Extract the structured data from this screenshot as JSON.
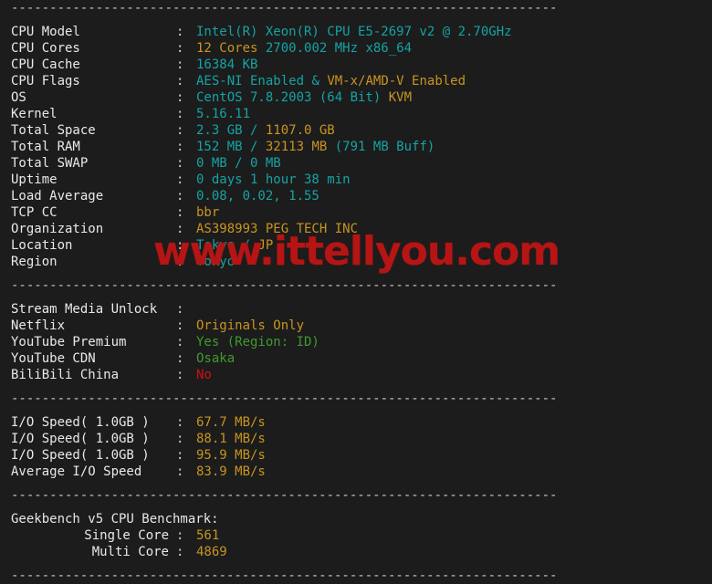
{
  "terminal": {
    "separator": "-----------------------------------------------------------------------",
    "watermark": "www.ittellyou.com",
    "colon": ":",
    "sections": [
      {
        "name": "system-info",
        "rows": [
          {
            "label": "CPU Model",
            "parts": [
              {
                "t": "Intel(R) Xeon(R) CPU E5-2697 v2 @ 2.70GHz",
                "c": "teal"
              }
            ]
          },
          {
            "label": "CPU Cores",
            "parts": [
              {
                "t": "12 Cores",
                "c": "orange"
              },
              {
                "t": " ",
                "c": "teal"
              },
              {
                "t": "2700.002 MHz x86_64",
                "c": "teal"
              }
            ]
          },
          {
            "label": "CPU Cache",
            "parts": [
              {
                "t": "16384 KB",
                "c": "teal"
              }
            ]
          },
          {
            "label": "CPU Flags",
            "parts": [
              {
                "t": "AES-NI Enabled",
                "c": "teal"
              },
              {
                "t": " & ",
                "c": "teal"
              },
              {
                "t": "VM-x/AMD-V Enabled",
                "c": "orange"
              }
            ]
          },
          {
            "label": "OS",
            "parts": [
              {
                "t": "CentOS 7.8.2003 (64 Bit) ",
                "c": "teal"
              },
              {
                "t": "KVM",
                "c": "orange"
              }
            ]
          },
          {
            "label": "Kernel",
            "parts": [
              {
                "t": "5.16.11",
                "c": "teal"
              }
            ]
          },
          {
            "label": "Total Space",
            "parts": [
              {
                "t": "2.3 GB",
                "c": "teal"
              },
              {
                "t": " / ",
                "c": "teal"
              },
              {
                "t": "1107.0 GB",
                "c": "orange"
              }
            ]
          },
          {
            "label": "Total RAM",
            "parts": [
              {
                "t": "152 MB",
                "c": "teal"
              },
              {
                "t": " / ",
                "c": "teal"
              },
              {
                "t": "32113 MB",
                "c": "orange"
              },
              {
                "t": " (791 MB Buff)",
                "c": "teal"
              }
            ]
          },
          {
            "label": "Total SWAP",
            "parts": [
              {
                "t": "0 MB / 0 MB",
                "c": "teal"
              }
            ]
          },
          {
            "label": "Uptime",
            "parts": [
              {
                "t": "0 days 1 hour 38 min",
                "c": "teal"
              }
            ]
          },
          {
            "label": "Load Average",
            "parts": [
              {
                "t": "0.08, 0.02, 1.55",
                "c": "teal"
              }
            ]
          },
          {
            "label": "TCP CC",
            "parts": [
              {
                "t": "bbr",
                "c": "orange"
              }
            ]
          },
          {
            "label": "Organization",
            "parts": [
              {
                "t": "AS398993 PEG TECH INC",
                "c": "orange"
              }
            ]
          },
          {
            "label": "Location",
            "parts": [
              {
                "t": "Tokyo / ",
                "c": "teal"
              },
              {
                "t": "JP",
                "c": "orange"
              }
            ]
          },
          {
            "label": "Region",
            "parts": [
              {
                "t": "Tokyo",
                "c": "teal"
              }
            ]
          }
        ]
      },
      {
        "name": "stream-media-unlock",
        "rows": [
          {
            "label": "Stream Media Unlock",
            "parts": []
          },
          {
            "label": "Netflix",
            "parts": [
              {
                "t": "Originals Only",
                "c": "orange"
              }
            ]
          },
          {
            "label": "YouTube Premium",
            "parts": [
              {
                "t": "Yes (Region: ID)",
                "c": "green"
              }
            ]
          },
          {
            "label": "YouTube CDN",
            "parts": [
              {
                "t": "Osaka",
                "c": "green"
              }
            ]
          },
          {
            "label": "BiliBili China",
            "parts": [
              {
                "t": "No",
                "c": "red"
              }
            ]
          }
        ]
      },
      {
        "name": "io-speed",
        "rows": [
          {
            "label": "I/O Speed( 1.0GB )",
            "parts": [
              {
                "t": "67.7 MB/s",
                "c": "orange"
              }
            ]
          },
          {
            "label": "I/O Speed( 1.0GB )",
            "parts": [
              {
                "t": "88.1 MB/s",
                "c": "orange"
              }
            ]
          },
          {
            "label": "I/O Speed( 1.0GB )",
            "parts": [
              {
                "t": "95.9 MB/s",
                "c": "orange"
              }
            ]
          },
          {
            "label": "Average I/O Speed",
            "parts": [
              {
                "t": "83.9 MB/s",
                "c": "orange"
              }
            ]
          }
        ]
      },
      {
        "name": "geekbench",
        "heading": "Geekbench v5 CPU Benchmark:",
        "rows": [
          {
            "label": "Single Core",
            "indent": true,
            "parts": [
              {
                "t": "561",
                "c": "orange"
              }
            ]
          },
          {
            "label": "Multi Core",
            "indent": true,
            "parts": [
              {
                "t": "4869",
                "c": "orange"
              }
            ]
          }
        ]
      }
    ]
  }
}
